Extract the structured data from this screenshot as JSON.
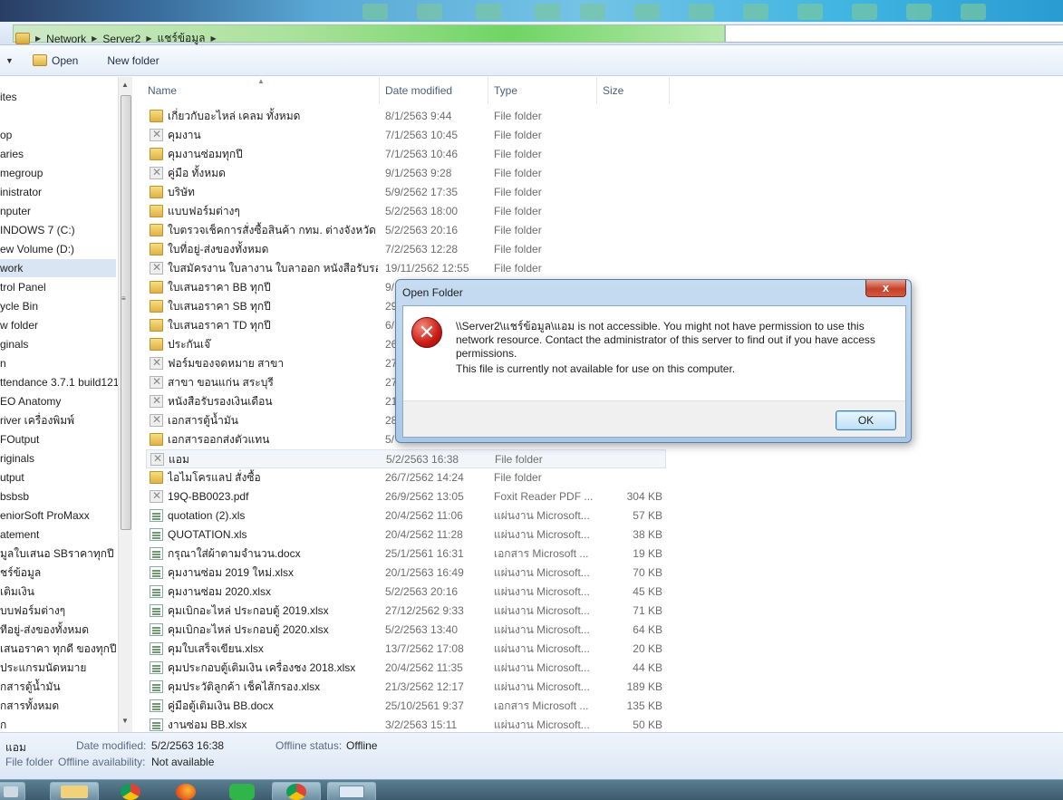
{
  "address": {
    "crumbs": [
      "Network",
      "Server2",
      "แชร์ข้อมูล"
    ]
  },
  "toolbar": {
    "open_label": "Open",
    "new_folder_label": "New folder"
  },
  "nav": {
    "items": [
      "ites",
      "op",
      "aries",
      "megroup",
      "inistrator",
      "nputer",
      "INDOWS 7 (C:)",
      "ew Volume (D:)",
      "work",
      "trol Panel",
      "ycle Bin",
      "w folder",
      "ginals",
      "n",
      "ttendance 3.7.1 build121",
      "EO Anatomy",
      "river เครื่องพิมพ์",
      "FOutput",
      "riginals",
      "utput",
      "bsbsb",
      "eniorSoft ProMaxx",
      "atement",
      "มูลใบเสนอ SBราคาทุกปี",
      "ชร์ข้อมูล",
      "เติมเงิน",
      "บบฟอร์มต่างๆ",
      "ทีอยู่-ส่งของทั้งหมด",
      "เสนอราคา ทุกดี ของทุกปี",
      "ประแกรมนัดหมาย",
      "กสารตู้น้ำมัน",
      "กสารทั้งหมด",
      "ก"
    ],
    "selected_index": 8
  },
  "columns": {
    "name": "Name",
    "date": "Date modified",
    "type": "Type",
    "size": "Size"
  },
  "files": [
    {
      "name": "เกี่ยวกับอะไหล่ เคลม ทั้งหมด",
      "date": "8/1/2563 9:44",
      "type": "File folder",
      "size": "",
      "icon": "folder"
    },
    {
      "name": "คุมงาน",
      "date": "7/1/2563 10:45",
      "type": "File folder",
      "size": "",
      "icon": "offline"
    },
    {
      "name": "คุมงานซ่อมทุกปี",
      "date": "7/1/2563 10:46",
      "type": "File folder",
      "size": "",
      "icon": "folder"
    },
    {
      "name": "คู่มือ ทั้งหมด",
      "date": "9/1/2563 9:28",
      "type": "File folder",
      "size": "",
      "icon": "offline"
    },
    {
      "name": "บริษัท",
      "date": "5/9/2562 17:35",
      "type": "File folder",
      "size": "",
      "icon": "folder"
    },
    {
      "name": "แบบฟอร์มต่างๆ",
      "date": "5/2/2563 18:00",
      "type": "File folder",
      "size": "",
      "icon": "folder"
    },
    {
      "name": "ใบตรวจเช็คการสั่งซื้อสินค้า กทม. ต่างจังหวัด",
      "date": "5/2/2563 20:16",
      "type": "File folder",
      "size": "",
      "icon": "folder"
    },
    {
      "name": "ใบที่อยู่-ส่งของทั้งหมด",
      "date": "7/2/2563 12:28",
      "type": "File folder",
      "size": "",
      "icon": "folder"
    },
    {
      "name": "ใบสมัครงาน ใบลางาน ใบลาออก หนังสือรับรอง",
      "date": "19/11/2562 12:55",
      "type": "File folder",
      "size": "",
      "icon": "offline"
    },
    {
      "name": "ใบเสนอราคา BB ทุกปี",
      "date": "9/",
      "type": "",
      "size": "",
      "icon": "folder"
    },
    {
      "name": "ใบเสนอราคา SB ทุกปี",
      "date": "29",
      "type": "",
      "size": "",
      "icon": "folder"
    },
    {
      "name": "ใบเสนอราคา TD ทุกปี",
      "date": "6/",
      "type": "",
      "size": "",
      "icon": "folder"
    },
    {
      "name": "ประกันเจ๊",
      "date": "26",
      "type": "",
      "size": "",
      "icon": "folder"
    },
    {
      "name": "ฟอร์มของจดหมาย สาขา",
      "date": "27",
      "type": "",
      "size": "",
      "icon": "offline"
    },
    {
      "name": "สาขา ขอนแก่น สระบุรี",
      "date": "27",
      "type": "",
      "size": "",
      "icon": "offline"
    },
    {
      "name": "หนังสือรับรองเงินเดือน",
      "date": "21",
      "type": "",
      "size": "",
      "icon": "offline"
    },
    {
      "name": "เอกสารตู้น้ำมัน",
      "date": "28",
      "type": "",
      "size": "",
      "icon": "offline"
    },
    {
      "name": "เอกสารออกส่งตัวแทน",
      "date": "5/",
      "type": "",
      "size": "",
      "icon": "folder"
    },
    {
      "name": "แอม",
      "date": "5/2/2563 16:38",
      "type": "File folder",
      "size": "",
      "icon": "offline"
    },
    {
      "name": "ไอไมโครแลป สั่งซื้อ",
      "date": "26/7/2562 14:24",
      "type": "File folder",
      "size": "",
      "icon": "folder"
    },
    {
      "name": "19Q-BB0023.pdf",
      "date": "26/9/2562 13:05",
      "type": "Foxit Reader PDF ...",
      "size": "304 KB",
      "icon": "offline"
    },
    {
      "name": "quotation (2).xls",
      "date": "20/4/2562 11:06",
      "type": "แผ่นงาน Microsoft...",
      "size": "57 KB",
      "icon": "file"
    },
    {
      "name": "QUOTATION.xls",
      "date": "20/4/2562 11:28",
      "type": "แผ่นงาน Microsoft...",
      "size": "38 KB",
      "icon": "file"
    },
    {
      "name": "กรุณาใส่ผ้าตามจำนวน.docx",
      "date": "25/1/2561 16:31",
      "type": "เอกสาร Microsoft ...",
      "size": "19 KB",
      "icon": "file"
    },
    {
      "name": "คุมงานซ่อม 2019 ใหม่.xlsx",
      "date": "20/1/2563 16:49",
      "type": "แผ่นงาน Microsoft...",
      "size": "70 KB",
      "icon": "file"
    },
    {
      "name": "คุมงานซ่อม 2020.xlsx",
      "date": "5/2/2563 20:16",
      "type": "แผ่นงาน Microsoft...",
      "size": "45 KB",
      "icon": "file"
    },
    {
      "name": "คุมเบิกอะไหล่ ประกอบตู้ 2019.xlsx",
      "date": "27/12/2562 9:33",
      "type": "แผ่นงาน Microsoft...",
      "size": "71 KB",
      "icon": "file"
    },
    {
      "name": "คุมเบิกอะไหล่ ประกอบตู้ 2020.xlsx",
      "date": "5/2/2563 13:40",
      "type": "แผ่นงาน Microsoft...",
      "size": "64 KB",
      "icon": "file"
    },
    {
      "name": "คุมใบเสร็จเขียน.xlsx",
      "date": "13/7/2562 17:08",
      "type": "แผ่นงาน Microsoft...",
      "size": "20 KB",
      "icon": "file"
    },
    {
      "name": "คุมประกอบตู้เติมเงิน เครื่องชง 2018.xlsx",
      "date": "20/4/2562 11:35",
      "type": "แผ่นงาน Microsoft...",
      "size": "44 KB",
      "icon": "file"
    },
    {
      "name": "คุมประวัติลูกค้า เช็คไส้กรอง.xlsx",
      "date": "21/3/2562 12:17",
      "type": "แผ่นงาน Microsoft...",
      "size": "189 KB",
      "icon": "file"
    },
    {
      "name": "คู่มือตู้เติมเงิน BB.docx",
      "date": "25/10/2561 9:37",
      "type": "เอกสาร Microsoft ...",
      "size": "135 KB",
      "icon": "file"
    },
    {
      "name": "งานซ่อม BB.xlsx",
      "date": "3/2/2563 15:11",
      "type": "แผ่นงาน Microsoft...",
      "size": "50 KB",
      "icon": "file"
    }
  ],
  "highlight_index": 18,
  "details": {
    "name": "แอม",
    "type": "File folder",
    "date_label": "Date modified:",
    "date_value": "5/2/2563 16:38",
    "avail_label": "Offline availability:",
    "avail_value": "Not available",
    "status_label": "Offline status:",
    "status_value": "Offline"
  },
  "dialog": {
    "title": "Open Folder",
    "message": "\\\\Server2\\แชร์ข้อมูล\\แอม is not accessible. You might not have permission to use this network resource. Contact the administrator of this server to find out if you have access permissions.",
    "sub_message": "This file is currently not available for use on this computer.",
    "ok_label": "OK",
    "close_glyph": "x",
    "icon_glyph": "✕"
  },
  "taskbar": {
    "apps": [
      "windows-explorer-icon",
      "file-manager-icon",
      "chrome-icon",
      "firefox-icon",
      "line-icon",
      "chrome-icon",
      "control-panel-icon"
    ]
  }
}
